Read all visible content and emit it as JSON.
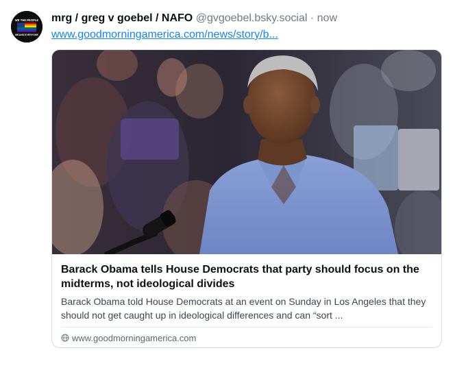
{
  "author": {
    "display_name": "mrg / greg v goebel / NAFO",
    "handle": "@gvgoebel.bsky.social",
    "separator": "·",
    "time": "now",
    "avatar_text_top": "WE THE PEOPLE",
    "avatar_text_bottom": "MEANS EVERYONE"
  },
  "post": {
    "link_text": "www.goodmorningamerica.com/news/story/b..."
  },
  "card": {
    "title": "Barack Obama tells House Democrats that party should focus on the midterms, not ideological divides",
    "description": "Barack Obama told House Democrats at an event on Sunday in Los Angeles that they should not get caught up in ideological differences and can “sort ...",
    "domain": "www.goodmorningamerica.com",
    "domain_icon": "globe-icon"
  },
  "colors": {
    "link": "#1083fe",
    "muted": "#6f7a86",
    "border": "#d4dbe2"
  }
}
